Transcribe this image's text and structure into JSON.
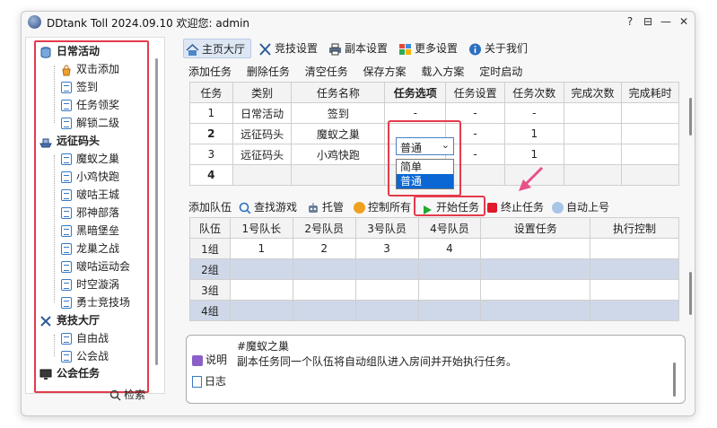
{
  "window": {
    "title": "DDtank Toll 2024.09.10 欢迎您: admin",
    "controls": [
      "?",
      "⊟",
      "—",
      "✕"
    ]
  },
  "tree": {
    "groups": [
      {
        "label": "日常活动",
        "items": [
          "双击添加",
          "签到",
          "任务领奖",
          "解锁二级"
        ]
      },
      {
        "label": "远征码头",
        "items": [
          "魔蚁之巢",
          "小鸡快跑",
          "啵咕王城",
          "邪神部落",
          "黑暗堡垒",
          "龙巢之战",
          "啵咕运动会",
          "时空漩涡",
          "勇士竞技场"
        ]
      },
      {
        "label": "竞技大厅",
        "items": [
          "自由战",
          "公会战"
        ]
      },
      {
        "label": "公会任务",
        "items": []
      }
    ],
    "search_label": "检索"
  },
  "toolbar": {
    "tabs": [
      {
        "label": "主页大厅",
        "icon": "home-icon"
      },
      {
        "label": "竞技设置",
        "icon": "swords-icon"
      },
      {
        "label": "副本设置",
        "icon": "printer-icon"
      },
      {
        "label": "更多设置",
        "icon": "grid-icon"
      },
      {
        "label": "关于我们",
        "icon": "info-icon"
      }
    ]
  },
  "task_actions": [
    "添加任务",
    "删除任务",
    "清空任务",
    "保存方案",
    "载入方案",
    "定时启动"
  ],
  "task_table": {
    "headers": [
      "任务",
      "类别",
      "任务名称",
      "任务选项",
      "任务设置",
      "任务次数",
      "完成次数",
      "完成耗时"
    ],
    "rows": [
      [
        "1",
        "日常活动",
        "签到",
        "-",
        "-",
        "-",
        "",
        ""
      ],
      [
        "2",
        "远征码头",
        "魔蚁之巢",
        "",
        "-",
        "1",
        "",
        ""
      ],
      [
        "3",
        "远征码头",
        "小鸡快跑",
        "",
        "-",
        "1",
        "",
        ""
      ],
      [
        "4",
        "",
        "",
        "",
        "",
        "",
        "",
        ""
      ]
    ]
  },
  "difficulty_combo": {
    "value": "普通",
    "options": [
      "简单",
      "普通"
    ]
  },
  "team_toolbar": {
    "add_team": "添加队伍",
    "find_game": "查找游戏",
    "host": "托管",
    "control_all": "控制所有",
    "start_task": "开始任务",
    "stop_task": "终止任务",
    "auto_login": "自动上号"
  },
  "team_table": {
    "headers": [
      "队伍",
      "1号队长",
      "2号队员",
      "3号队员",
      "4号队员",
      "设置任务",
      "执行控制"
    ],
    "rows": [
      [
        "1组",
        "1",
        "2",
        "3",
        "4",
        "",
        ""
      ],
      [
        "2组",
        "",
        "",
        "",
        "",
        "",
        ""
      ],
      [
        "3组",
        "",
        "",
        "",
        "",
        "",
        ""
      ],
      [
        "4组",
        "",
        "",
        "",
        "",
        "",
        ""
      ]
    ]
  },
  "bottom": {
    "tab_desc": "说明",
    "tab_log": "日志",
    "title": "#魔蚁之巢",
    "text": "副本任务同一个队伍将自动组队进入房间并开始执行任务。"
  },
  "colors": {
    "highlight_red": "#e43b4c",
    "selection_blue": "#0a67d3",
    "selected_row": "#cfd8e8",
    "start_green": "#22aa33",
    "stop_red": "#e01a2a"
  }
}
